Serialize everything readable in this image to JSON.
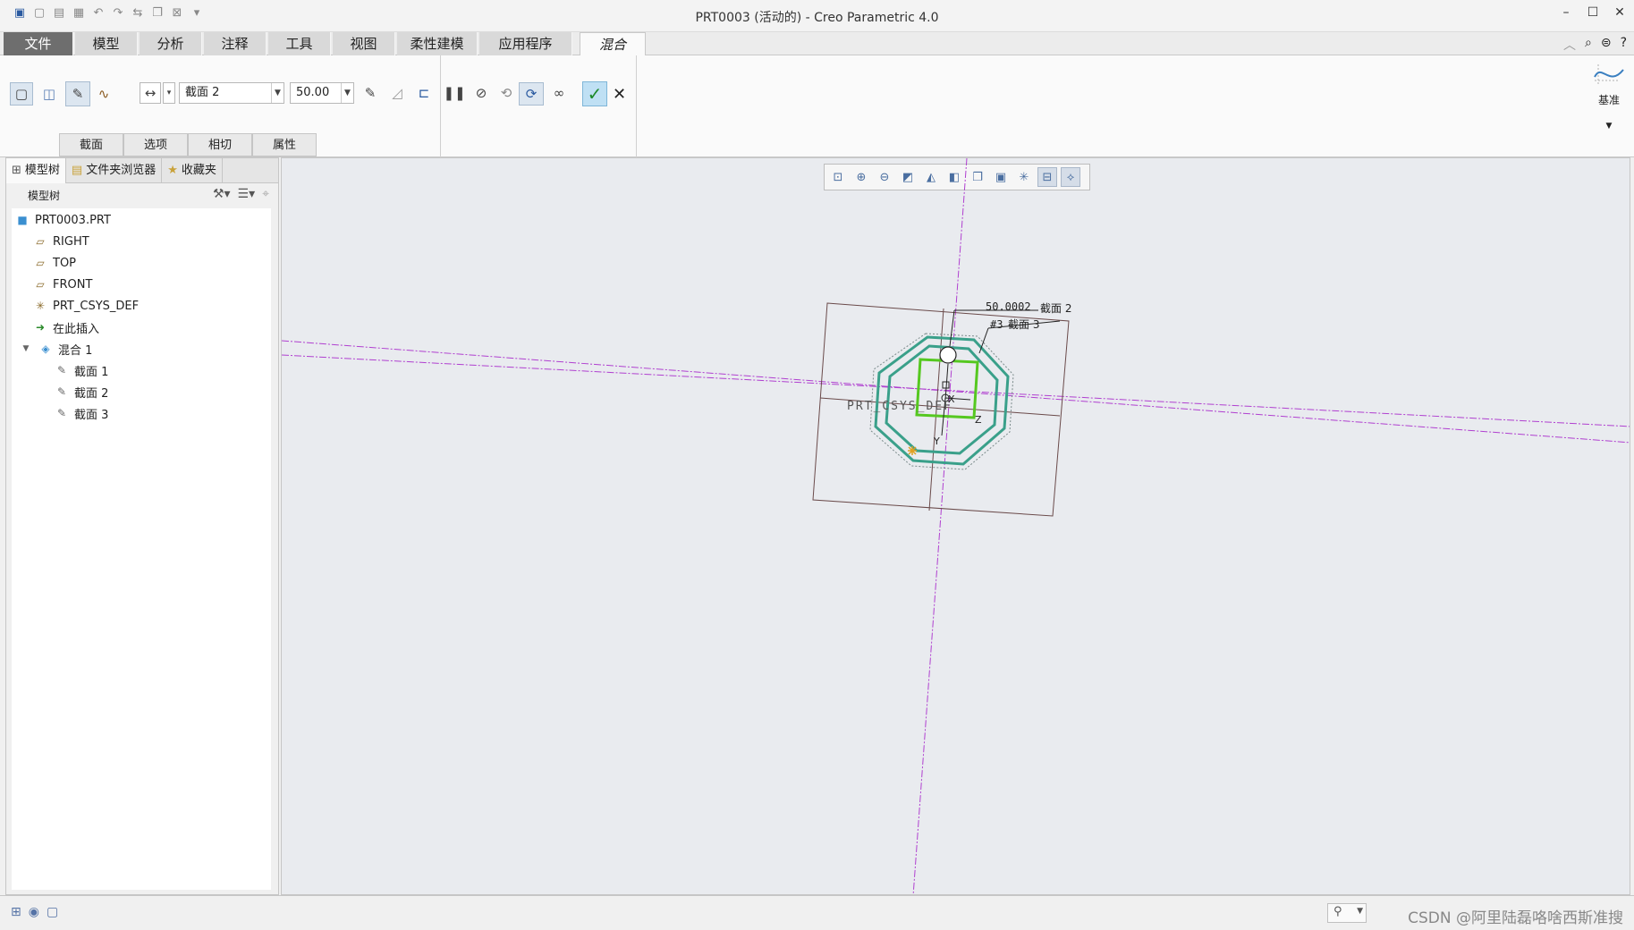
{
  "app": {
    "title": "PRT0003 (活动的) - Creo Parametric 4.0"
  },
  "ribbon_tabs": [
    {
      "label": "文件"
    },
    {
      "label": "模型"
    },
    {
      "label": "分析"
    },
    {
      "label": "注释"
    },
    {
      "label": "工具"
    },
    {
      "label": "视图"
    },
    {
      "label": "柔性建模"
    },
    {
      "label": "应用程序"
    },
    {
      "label": "混合"
    }
  ],
  "ribbon": {
    "section_select": "截面 2",
    "depth_value": "50.00",
    "subtabs": [
      {
        "label": "截面"
      },
      {
        "label": "选项"
      },
      {
        "label": "相切"
      },
      {
        "label": "属性"
      }
    ],
    "datum_label": "基准"
  },
  "panel": {
    "tabs": [
      {
        "label": "模型树"
      },
      {
        "label": "文件夹浏览器"
      },
      {
        "label": "收藏夹"
      }
    ],
    "tree_header": "模型树",
    "tree": [
      {
        "label": "PRT0003.PRT",
        "icon": "part-icon"
      },
      {
        "label": "RIGHT",
        "icon": "datum-plane-icon"
      },
      {
        "label": "TOP",
        "icon": "datum-plane-icon"
      },
      {
        "label": "FRONT",
        "icon": "datum-plane-icon"
      },
      {
        "label": "PRT_CSYS_DEF",
        "icon": "csys-icon"
      },
      {
        "label": "在此插入",
        "icon": "insert-here-arrow-icon"
      },
      {
        "label": "混合 1",
        "icon": "blend-feature-icon"
      },
      {
        "label": "截面 1",
        "icon": "sketch-icon"
      },
      {
        "label": "截面 2",
        "icon": "sketch-icon"
      },
      {
        "label": "截面 3",
        "icon": "sketch-icon"
      }
    ]
  },
  "viewport": {
    "csys_label": "PRT_CSYS_DEF",
    "dim_label_1": "50.0002",
    "section_label_2": "截面 2",
    "dim_label_2": "#3",
    "section_label_3": "截面 3",
    "axis_x": "X",
    "axis_y": "Y",
    "axis_z": "Z"
  },
  "status": {
    "watermark": "CSDN @阿里陆磊咯啥西斯准搜"
  },
  "colors": {
    "file_tab": "#6e6e6e",
    "datum_line": "#b040d0",
    "section_outer": "#3aa08a",
    "section_active": "#55c820",
    "ok_check": "#1d8a2a"
  }
}
